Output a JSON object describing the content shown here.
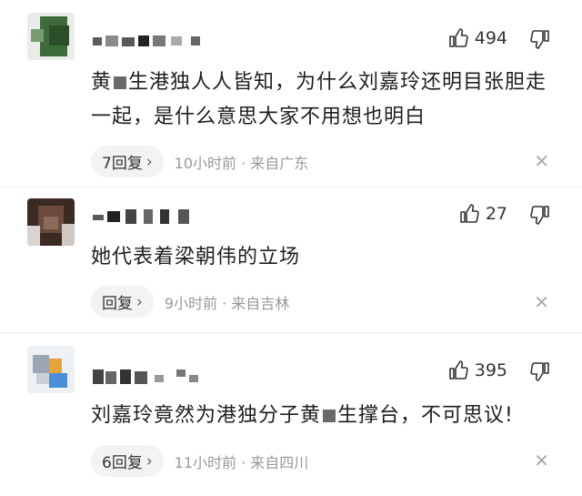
{
  "comments": [
    {
      "text_a": "黄",
      "text_b": "生港独人人皆知，为什么刘嘉玲还明目张胆走一起，是什么意思大家不用想也明白",
      "likes": "494",
      "reply_label": "7回复",
      "time": "10小时前 · 来自广东"
    },
    {
      "text": "她代表着梁朝伟的立场",
      "likes": "27",
      "reply_label": "回复",
      "time": "9小时前 · 来自吉林"
    },
    {
      "text_a": "刘嘉玲竟然为港独分子黄",
      "text_b": "生撑台，不可思议!",
      "likes": "395",
      "reply_label": "6回复",
      "time": "11小时前 · 来自四川"
    }
  ],
  "icons": {
    "like": "thumbs-up-icon",
    "dislike": "thumbs-down-icon",
    "close": "close-icon",
    "chevron": "chevron-right-icon"
  },
  "glyphs": {
    "chevron": "›",
    "close": "✕"
  },
  "colors": {
    "text": "#1f1f1f",
    "meta": "#999999",
    "pill": "#f3f3f3"
  }
}
